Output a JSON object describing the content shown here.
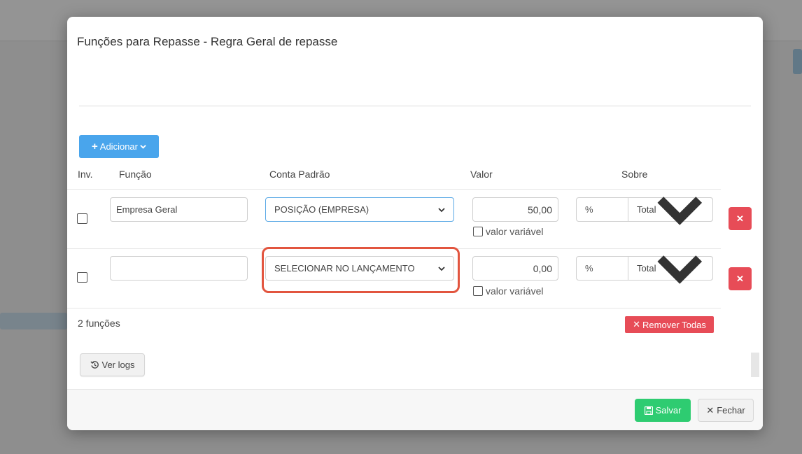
{
  "modal": {
    "title": "Funções para Repasse - Regra Geral de repasse"
  },
  "toolbar": {
    "add_label": "Adicionar"
  },
  "table": {
    "headers": {
      "inv": "Inv.",
      "funcao": "Função",
      "conta_padrao": "Conta Padrão",
      "valor": "Valor",
      "sobre": "Sobre"
    },
    "rows": [
      {
        "funcao": "Empresa Geral",
        "conta_padrao": "POSIÇÃO (EMPRESA)",
        "valor": "50,00",
        "valor_variavel_label": "valor variável",
        "unit": "%",
        "sobre": "Total"
      },
      {
        "funcao": "",
        "conta_padrao": "SELECIONAR NO LANÇAMENTO",
        "valor": "0,00",
        "valor_variavel_label": "valor variável",
        "unit": "%",
        "sobre": "Total"
      }
    ]
  },
  "summary": {
    "count_label": "2 funções",
    "remove_all_label": "Remover Todas"
  },
  "logs_button_label": "Ver logs",
  "footer": {
    "save_label": "Salvar",
    "close_label": "Fechar"
  },
  "colors": {
    "primary": "#49a5ec",
    "danger": "#e74c57",
    "success": "#2ecc71",
    "highlight": "#e2553f"
  }
}
